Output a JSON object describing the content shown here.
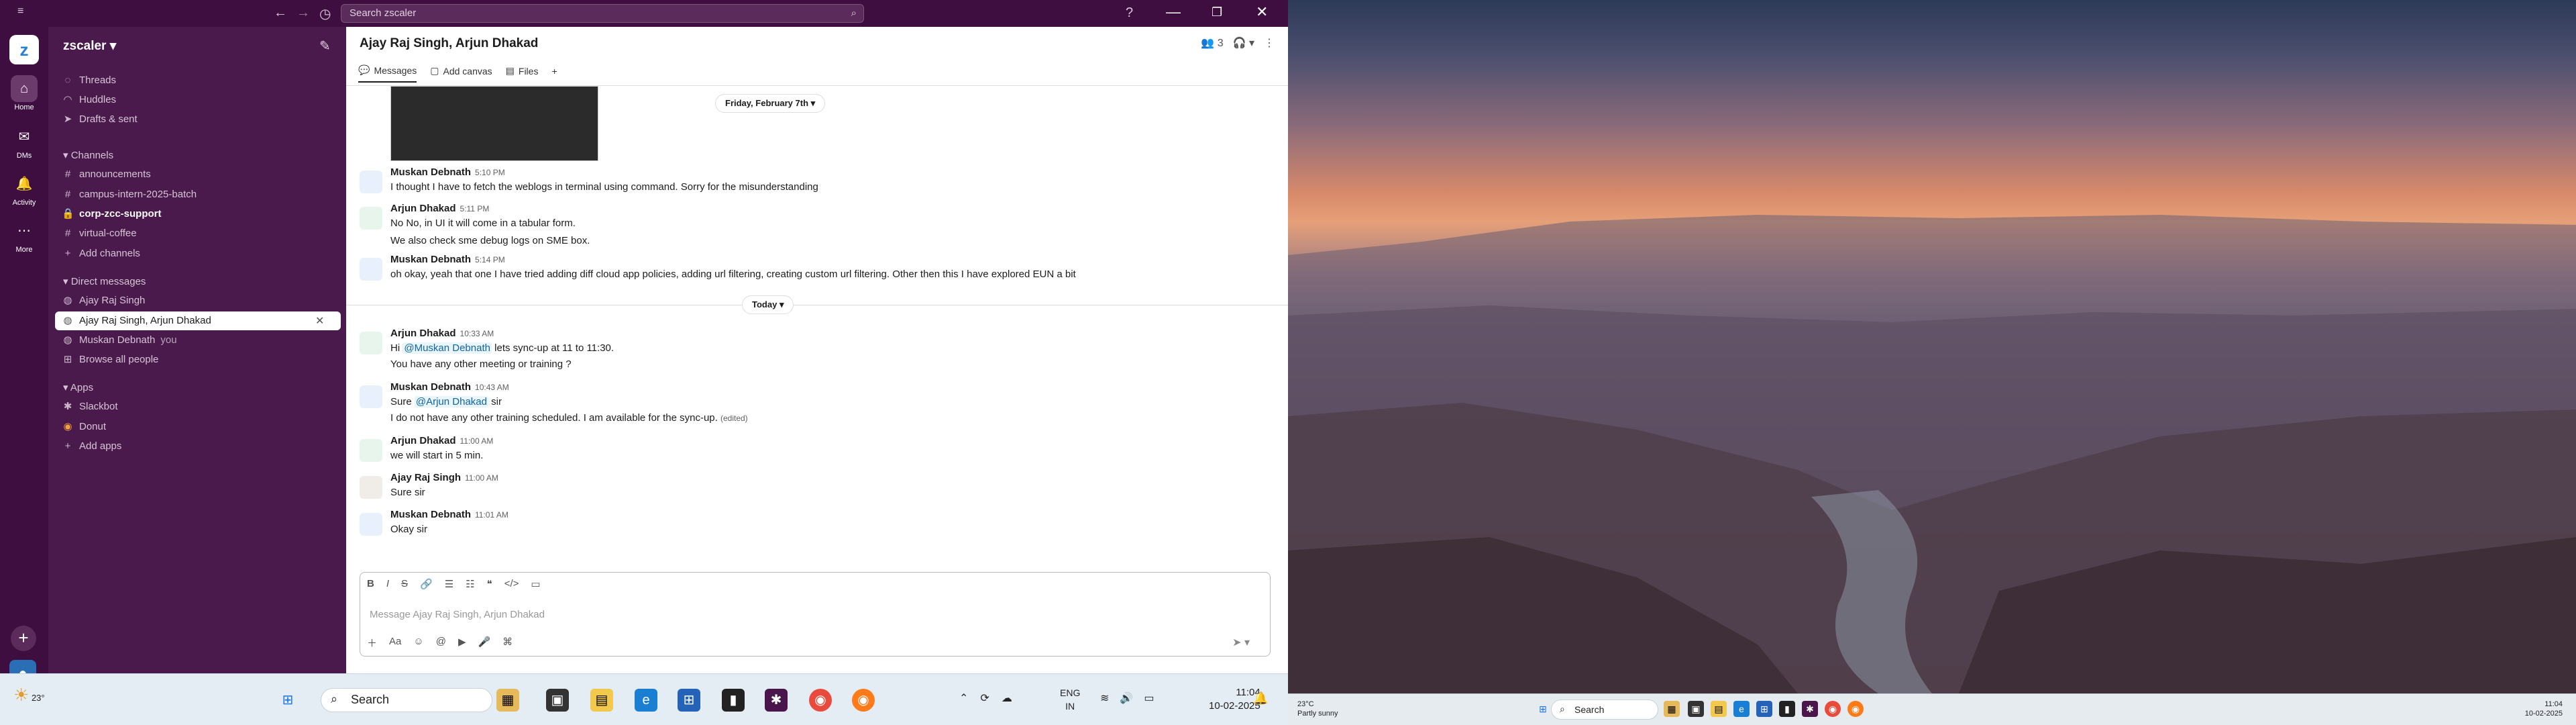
{
  "titlebar": {
    "search_placeholder": "Search zscaler"
  },
  "rail": {
    "home": "Home",
    "dms": "DMs",
    "activity": "Activity",
    "more": "More"
  },
  "sidebar": {
    "workspace": "zscaler",
    "nav": [
      {
        "label": "Threads"
      },
      {
        "label": "Huddles"
      },
      {
        "label": "Drafts & sent"
      }
    ],
    "channels_header": "Channels",
    "channels": [
      {
        "label": "announcements"
      },
      {
        "label": "campus-intern-2025-batch"
      },
      {
        "label": "corp-zcc-support"
      },
      {
        "label": "virtual-coffee"
      }
    ],
    "add_channels": "Add channels",
    "dm_header": "Direct messages",
    "dms": [
      {
        "label": "Ajay Raj Singh"
      },
      {
        "label": "Ajay Raj Singh, Arjun Dhakad"
      },
      {
        "label": "Muskan Debnath",
        "suffix": "you"
      }
    ],
    "browse_people": "Browse all people",
    "apps_header": "Apps",
    "apps": [
      {
        "label": "Slackbot"
      },
      {
        "label": "Donut"
      }
    ],
    "add_apps": "Add apps"
  },
  "channel": {
    "title": "Ajay Raj Singh, Arjun Dhakad",
    "member_count": "3",
    "tabs": [
      {
        "label": "Messages"
      },
      {
        "label": "Add canvas"
      },
      {
        "label": "Files"
      }
    ]
  },
  "dividers": {
    "friday": "Friday, February 7th",
    "today": "Today"
  },
  "messages": [
    {
      "author": "Muskan Debnath",
      "time": "5:10 PM",
      "lines": [
        "I thought I have to fetch the weblogs in terminal using command. Sorry for the misunderstanding"
      ]
    },
    {
      "author": "Arjun Dhakad",
      "time": "5:11 PM",
      "lines": [
        "No No, in UI it will come in a tabular form.",
        "We also check sme debug logs on SME box."
      ]
    },
    {
      "author": "Muskan Debnath",
      "time": "5:14 PM",
      "lines": [
        "oh okay, yeah that one I have tried adding diff cloud app policies, adding url filtering, creating custom url filtering. Other then this I have explored EUN a bit"
      ]
    },
    {
      "author": "Arjun Dhakad",
      "time": "10:33 AM",
      "pre": "Hi",
      "mention": "@Muskan Debnath",
      "post": "lets sync-up at 11 to 11:30.",
      "line2": "You have any other meeting or training ?"
    },
    {
      "author": "Muskan Debnath",
      "time": "10:43 AM",
      "pre": "Sure",
      "mention": "@Arjun Dhakad",
      "post": "sir",
      "line2": "I do not have any other training scheduled. I am available for the sync-up.",
      "edited": "(edited)"
    },
    {
      "author": "Arjun Dhakad",
      "time": "11:00 AM",
      "lines": [
        "we will start in 5 min."
      ]
    },
    {
      "author": "Ajay Raj Singh",
      "time": "11:00 AM",
      "lines": [
        "Sure sir"
      ]
    },
    {
      "author": "Muskan Debnath",
      "time": "11:01 AM",
      "lines": [
        "Okay sir"
      ]
    }
  ],
  "composer": {
    "placeholder": "Message Ajay Raj Singh, Arjun Dhakad"
  },
  "taskbar": {
    "temp": "23°",
    "search": "Search",
    "lang1": "ENG",
    "lang2": "IN",
    "time": "11:04",
    "date": "10-02-2025"
  },
  "taskbar2": {
    "temp": "23°C",
    "condition": "Partly sunny",
    "search": "Search",
    "time": "11:04",
    "date": "10-02-2025"
  }
}
